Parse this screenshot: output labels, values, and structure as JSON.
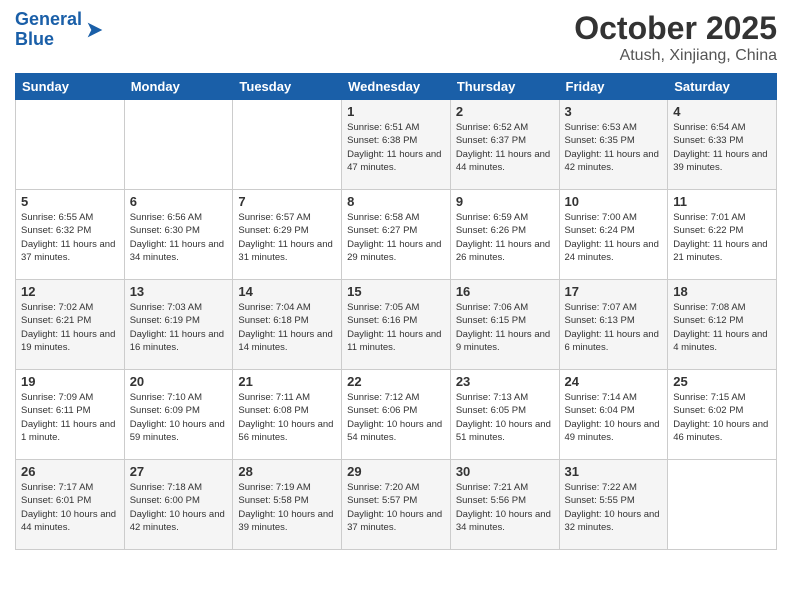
{
  "header": {
    "logo_line1": "General",
    "logo_line2": "Blue",
    "title": "October 2025",
    "subtitle": "Atush, Xinjiang, China"
  },
  "weekdays": [
    "Sunday",
    "Monday",
    "Tuesday",
    "Wednesday",
    "Thursday",
    "Friday",
    "Saturday"
  ],
  "weeks": [
    [
      {
        "day": "",
        "info": ""
      },
      {
        "day": "",
        "info": ""
      },
      {
        "day": "",
        "info": ""
      },
      {
        "day": "1",
        "info": "Sunrise: 6:51 AM\nSunset: 6:38 PM\nDaylight: 11 hours and 47 minutes."
      },
      {
        "day": "2",
        "info": "Sunrise: 6:52 AM\nSunset: 6:37 PM\nDaylight: 11 hours and 44 minutes."
      },
      {
        "day": "3",
        "info": "Sunrise: 6:53 AM\nSunset: 6:35 PM\nDaylight: 11 hours and 42 minutes."
      },
      {
        "day": "4",
        "info": "Sunrise: 6:54 AM\nSunset: 6:33 PM\nDaylight: 11 hours and 39 minutes."
      }
    ],
    [
      {
        "day": "5",
        "info": "Sunrise: 6:55 AM\nSunset: 6:32 PM\nDaylight: 11 hours and 37 minutes."
      },
      {
        "day": "6",
        "info": "Sunrise: 6:56 AM\nSunset: 6:30 PM\nDaylight: 11 hours and 34 minutes."
      },
      {
        "day": "7",
        "info": "Sunrise: 6:57 AM\nSunset: 6:29 PM\nDaylight: 11 hours and 31 minutes."
      },
      {
        "day": "8",
        "info": "Sunrise: 6:58 AM\nSunset: 6:27 PM\nDaylight: 11 hours and 29 minutes."
      },
      {
        "day": "9",
        "info": "Sunrise: 6:59 AM\nSunset: 6:26 PM\nDaylight: 11 hours and 26 minutes."
      },
      {
        "day": "10",
        "info": "Sunrise: 7:00 AM\nSunset: 6:24 PM\nDaylight: 11 hours and 24 minutes."
      },
      {
        "day": "11",
        "info": "Sunrise: 7:01 AM\nSunset: 6:22 PM\nDaylight: 11 hours and 21 minutes."
      }
    ],
    [
      {
        "day": "12",
        "info": "Sunrise: 7:02 AM\nSunset: 6:21 PM\nDaylight: 11 hours and 19 minutes."
      },
      {
        "day": "13",
        "info": "Sunrise: 7:03 AM\nSunset: 6:19 PM\nDaylight: 11 hours and 16 minutes."
      },
      {
        "day": "14",
        "info": "Sunrise: 7:04 AM\nSunset: 6:18 PM\nDaylight: 11 hours and 14 minutes."
      },
      {
        "day": "15",
        "info": "Sunrise: 7:05 AM\nSunset: 6:16 PM\nDaylight: 11 hours and 11 minutes."
      },
      {
        "day": "16",
        "info": "Sunrise: 7:06 AM\nSunset: 6:15 PM\nDaylight: 11 hours and 9 minutes."
      },
      {
        "day": "17",
        "info": "Sunrise: 7:07 AM\nSunset: 6:13 PM\nDaylight: 11 hours and 6 minutes."
      },
      {
        "day": "18",
        "info": "Sunrise: 7:08 AM\nSunset: 6:12 PM\nDaylight: 11 hours and 4 minutes."
      }
    ],
    [
      {
        "day": "19",
        "info": "Sunrise: 7:09 AM\nSunset: 6:11 PM\nDaylight: 11 hours and 1 minute."
      },
      {
        "day": "20",
        "info": "Sunrise: 7:10 AM\nSunset: 6:09 PM\nDaylight: 10 hours and 59 minutes."
      },
      {
        "day": "21",
        "info": "Sunrise: 7:11 AM\nSunset: 6:08 PM\nDaylight: 10 hours and 56 minutes."
      },
      {
        "day": "22",
        "info": "Sunrise: 7:12 AM\nSunset: 6:06 PM\nDaylight: 10 hours and 54 minutes."
      },
      {
        "day": "23",
        "info": "Sunrise: 7:13 AM\nSunset: 6:05 PM\nDaylight: 10 hours and 51 minutes."
      },
      {
        "day": "24",
        "info": "Sunrise: 7:14 AM\nSunset: 6:04 PM\nDaylight: 10 hours and 49 minutes."
      },
      {
        "day": "25",
        "info": "Sunrise: 7:15 AM\nSunset: 6:02 PM\nDaylight: 10 hours and 46 minutes."
      }
    ],
    [
      {
        "day": "26",
        "info": "Sunrise: 7:17 AM\nSunset: 6:01 PM\nDaylight: 10 hours and 44 minutes."
      },
      {
        "day": "27",
        "info": "Sunrise: 7:18 AM\nSunset: 6:00 PM\nDaylight: 10 hours and 42 minutes."
      },
      {
        "day": "28",
        "info": "Sunrise: 7:19 AM\nSunset: 5:58 PM\nDaylight: 10 hours and 39 minutes."
      },
      {
        "day": "29",
        "info": "Sunrise: 7:20 AM\nSunset: 5:57 PM\nDaylight: 10 hours and 37 minutes."
      },
      {
        "day": "30",
        "info": "Sunrise: 7:21 AM\nSunset: 5:56 PM\nDaylight: 10 hours and 34 minutes."
      },
      {
        "day": "31",
        "info": "Sunrise: 7:22 AM\nSunset: 5:55 PM\nDaylight: 10 hours and 32 minutes."
      },
      {
        "day": "",
        "info": ""
      }
    ]
  ]
}
